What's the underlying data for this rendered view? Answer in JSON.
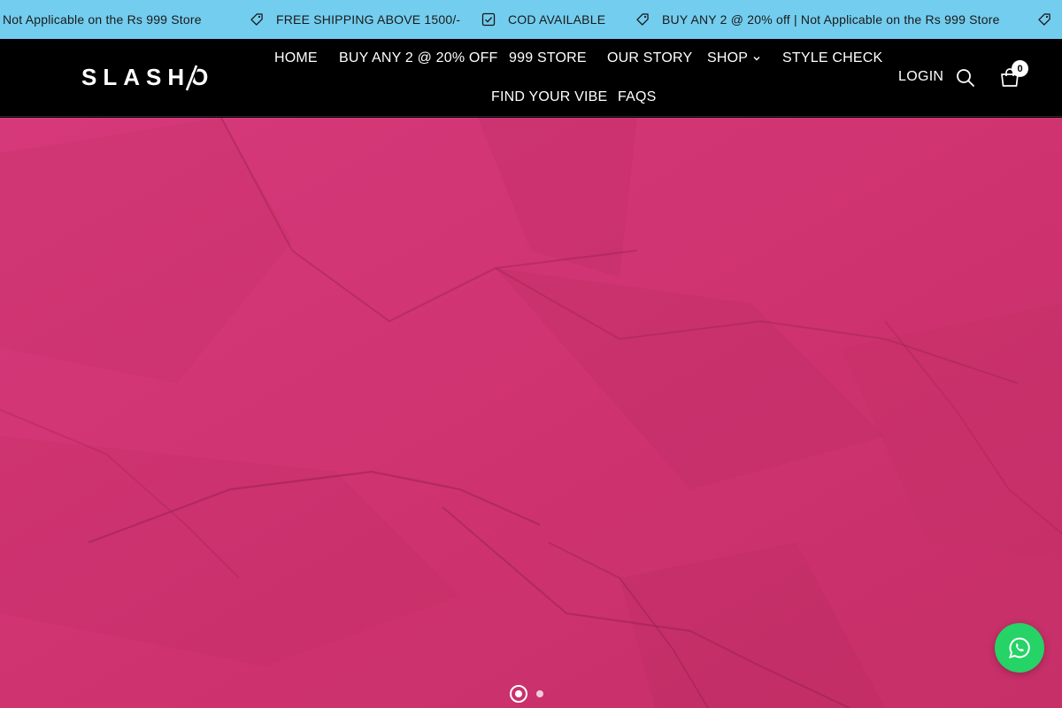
{
  "announcements": [
    {
      "text": "Not Applicable on the Rs 999 Store",
      "icon": "none"
    },
    {
      "text": "FREE SHIPPING ABOVE 1500/-",
      "icon": "tag-icon"
    },
    {
      "text": "COD AVAILABLE",
      "icon": "checkbox-icon"
    },
    {
      "text": "BUY ANY 2 @ 20% off | Not Applicable on the Rs 999 Store",
      "icon": "tag-icon"
    }
  ],
  "brand": {
    "logo_text": "SLASHO"
  },
  "nav": {
    "home": "HOME",
    "buy_any_2": "BUY ANY 2 @ 20% OFF",
    "store_999": "999 STORE",
    "our_story": "OUR STORY",
    "shop": "SHOP",
    "style_check": "STYLE CHECK",
    "find_your_vibe": "FIND YOUR VIBE",
    "faqs": "FAQS"
  },
  "header_actions": {
    "login": "LOGIN",
    "cart_count": "0"
  },
  "hero": {
    "slides_total": 2,
    "active_slide": 1
  },
  "colors": {
    "announcement_bg": "#73cdee",
    "header_bg": "#000000",
    "hero_pink": "#d3356f",
    "whatsapp_green": "#25d366"
  }
}
